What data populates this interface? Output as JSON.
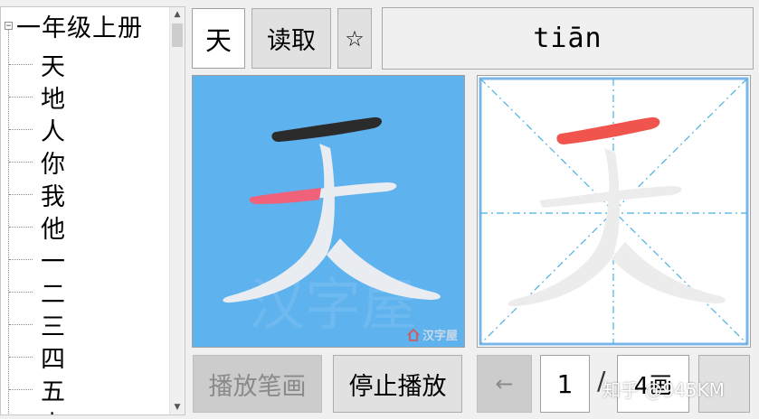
{
  "tree": {
    "root_label": "一年级上册",
    "expander_glyph": "⊟",
    "items": [
      "天",
      "地",
      "人",
      "你",
      "我",
      "他",
      "一",
      "二",
      "三",
      "四",
      "五",
      "上"
    ]
  },
  "top": {
    "character": "天",
    "read_label": "读取",
    "star_glyph": "☆",
    "pinyin": "tiān"
  },
  "left_panel": {
    "background": "#5eb2ee",
    "watermark_big": "汉字屋",
    "watermark_logo": "汉字屋"
  },
  "bottom": {
    "play_label": "播放笔画",
    "stop_label": "停止播放",
    "prev_glyph": "←",
    "current_stroke": "1",
    "separator": "/",
    "total_strokes": "4画",
    "next_glyph": ""
  },
  "watermark_text": "知乎 @945KM",
  "icons": {
    "expander": "minus-box-icon",
    "star": "star-outline-icon",
    "prev": "arrow-left-icon",
    "logo": "house-icon"
  },
  "colors": {
    "stroke_done": "#2b2b2b",
    "stroke_current_left": "#f0627a",
    "stroke_current_right": "#f0544c",
    "guide_lines": "#49b1e0",
    "panel_selected_border": "#7ab6e8"
  }
}
